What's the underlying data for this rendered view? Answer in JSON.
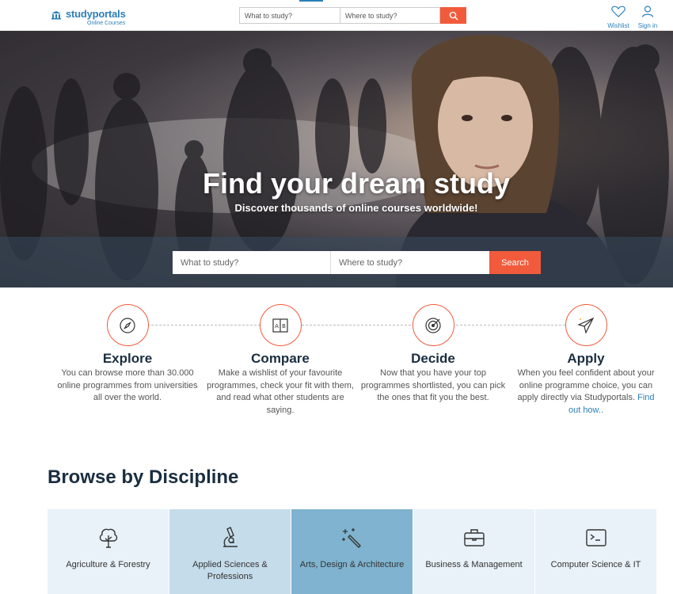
{
  "header": {
    "brand": "studyportals",
    "brand_sub": "Online Courses",
    "search_what_placeholder": "What to study?",
    "search_where_placeholder": "Where to study?",
    "wishlist_label": "Wishlist",
    "signin_label": "Sign in"
  },
  "hero": {
    "title": "Find your dream study",
    "subtitle": "Discover thousands of online courses worldwide!",
    "search_what_placeholder": "What to study?",
    "search_where_placeholder": "Where to study?",
    "search_button": "Search"
  },
  "steps": [
    {
      "title": "Explore",
      "text": "You can browse more than 30.000 online programmes from universities all over the world.",
      "icon": "compass-icon"
    },
    {
      "title": "Compare",
      "text": "Make a wishlist of your favourite programmes, check your fit with them, and read what other students are saying.",
      "icon": "compare-icon"
    },
    {
      "title": "Decide",
      "text": "Now that you have your top programmes shortlisted, you can pick the ones that fit you the best.",
      "icon": "target-icon"
    },
    {
      "title": "Apply",
      "text": "When you feel confident about your online programme choice, you can apply directly via Studyportals.",
      "link": "Find out how..",
      "icon": "paper-plane-icon"
    }
  ],
  "browse": {
    "title": "Browse by Discipline",
    "disciplines": [
      {
        "label": "Agriculture & Forestry",
        "icon": "tree-icon"
      },
      {
        "label": "Applied Sciences & Professions",
        "icon": "microscope-icon"
      },
      {
        "label": "Arts, Design & Architecture",
        "icon": "magic-wand-icon"
      },
      {
        "label": "Business & Management",
        "icon": "briefcase-icon"
      },
      {
        "label": "Computer Science & IT",
        "icon": "terminal-icon"
      }
    ]
  },
  "colors": {
    "accent": "#f15b3c",
    "brand": "#2c7fb8",
    "heading": "#1a2e40"
  }
}
